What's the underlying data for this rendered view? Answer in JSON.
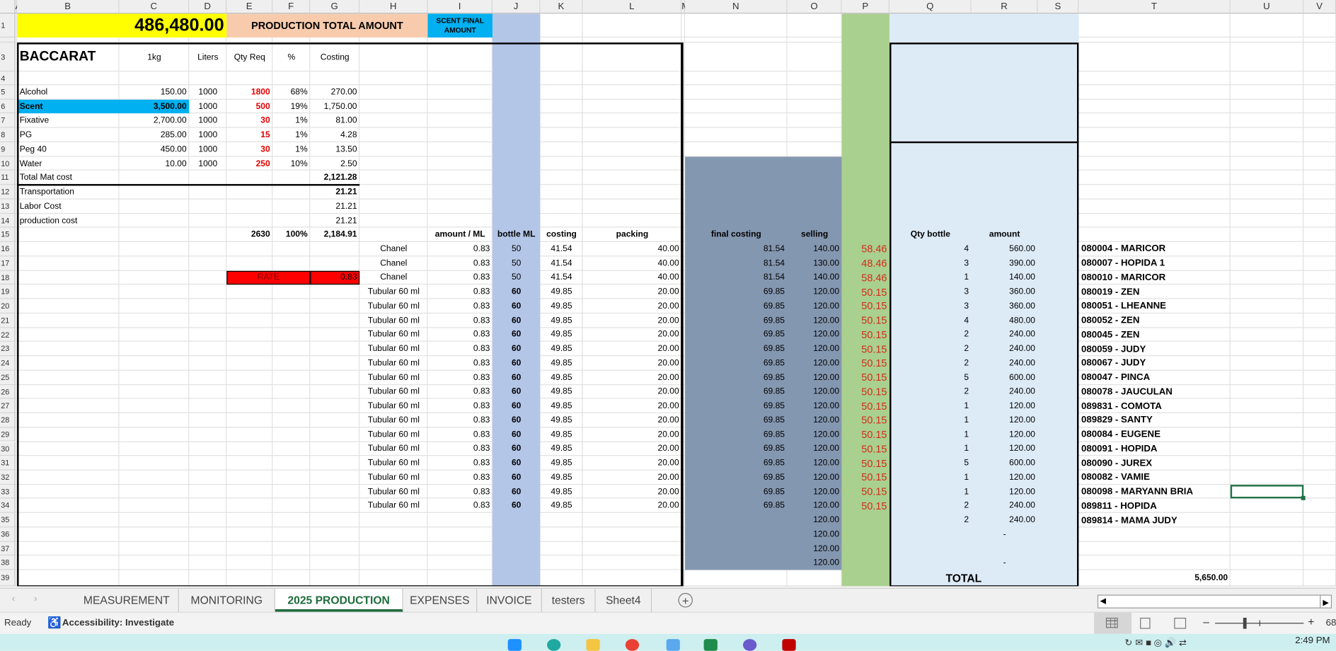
{
  "columns": [
    "A",
    "B",
    "C",
    "D",
    "E",
    "F",
    "G",
    "H",
    "I",
    "J",
    "K",
    "L",
    "M",
    "N",
    "O",
    "P",
    "Q",
    "R",
    "S",
    "T",
    "U",
    "V"
  ],
  "header": {
    "grand_total": "486,480.00",
    "production_total_label": "PRODUCTION TOTAL AMOUNT",
    "scent_final_label": "SCENT FINAL AMOUNT"
  },
  "recipe": {
    "title": "BACCARAT",
    "col_headers": [
      "1kg",
      "Liters",
      "Qty Req",
      "%",
      "Costing"
    ],
    "materials": [
      {
        "name": "Alcohol",
        "price": "150.00",
        "liters": "1000",
        "qty": "1800",
        "pct": "68%",
        "cost": "270.00"
      },
      {
        "name": "Scent",
        "price": "3,500.00",
        "liters": "1000",
        "qty": "500",
        "pct": "19%",
        "cost": "1,750.00"
      },
      {
        "name": "Fixative",
        "price": "2,700.00",
        "liters": "1000",
        "qty": "30",
        "pct": "1%",
        "cost": "81.00"
      },
      {
        "name": "PG",
        "price": "285.00",
        "liters": "1000",
        "qty": "15",
        "pct": "1%",
        "cost": "4.28"
      },
      {
        "name": "Peg 40",
        "price": "450.00",
        "liters": "1000",
        "qty": "30",
        "pct": "1%",
        "cost": "13.50"
      },
      {
        "name": "Water",
        "price": "10.00",
        "liters": "1000",
        "qty": "250",
        "pct": "10%",
        "cost": "2.50"
      }
    ],
    "totals": [
      {
        "label": "Total Mat cost",
        "value": "2,121.28"
      },
      {
        "label": "Transportation",
        "value": "21.21"
      },
      {
        "label": "Labor Cost",
        "value": "21.21"
      },
      {
        "label": "production cost",
        "value": "21.21"
      }
    ],
    "sum_qty": "2630",
    "sum_pct": "100%",
    "sum_cost": "2,184.91",
    "rate_label": "RATE",
    "rate_value": "0.83"
  },
  "product_headers": {
    "amount_ml": "amount / ML",
    "bottle_ml": "bottle  ML",
    "costing": "costing",
    "packing": "packing",
    "final": "final costing",
    "selling": "selling",
    "qty": "Qty bottle",
    "amount": "amount"
  },
  "products": [
    {
      "name": "Chanel",
      "aml": "0.83",
      "bottle": "50",
      "costing": "41.54",
      "packing": "40.00",
      "final": "81.54",
      "selling": "140.00",
      "margin": "58.46",
      "qty": "4",
      "amount": "560.00",
      "customer": "080004 - MARICOR"
    },
    {
      "name": "Chanel",
      "aml": "0.83",
      "bottle": "50",
      "costing": "41.54",
      "packing": "40.00",
      "final": "81.54",
      "selling": "130.00",
      "margin": "48.46",
      "qty": "3",
      "amount": "390.00",
      "customer": "080007 - HOPIDA 1"
    },
    {
      "name": "Chanel",
      "aml": "0.83",
      "bottle": "50",
      "costing": "41.54",
      "packing": "40.00",
      "final": "81.54",
      "selling": "140.00",
      "margin": "58.46",
      "qty": "1",
      "amount": "140.00",
      "customer": "080010 - MARICOR"
    },
    {
      "name": "Tubular  60 ml",
      "aml": "0.83",
      "bottle": "60",
      "costing": "49.85",
      "packing": "20.00",
      "final": "69.85",
      "selling": "120.00",
      "margin": "50.15",
      "qty": "3",
      "amount": "360.00",
      "customer": "080019 - ZEN"
    },
    {
      "name": "Tubular  60 ml",
      "aml": "0.83",
      "bottle": "60",
      "costing": "49.85",
      "packing": "20.00",
      "final": "69.85",
      "selling": "120.00",
      "margin": "50.15",
      "qty": "3",
      "amount": "360.00",
      "customer": "080051 - LHEANNE"
    },
    {
      "name": "Tubular  60 ml",
      "aml": "0.83",
      "bottle": "60",
      "costing": "49.85",
      "packing": "20.00",
      "final": "69.85",
      "selling": "120.00",
      "margin": "50.15",
      "qty": "4",
      "amount": "480.00",
      "customer": "080052 - ZEN"
    },
    {
      "name": "Tubular  60 ml",
      "aml": "0.83",
      "bottle": "60",
      "costing": "49.85",
      "packing": "20.00",
      "final": "69.85",
      "selling": "120.00",
      "margin": "50.15",
      "qty": "2",
      "amount": "240.00",
      "customer": "080045 - ZEN"
    },
    {
      "name": "Tubular  60 ml",
      "aml": "0.83",
      "bottle": "60",
      "costing": "49.85",
      "packing": "20.00",
      "final": "69.85",
      "selling": "120.00",
      "margin": "50.15",
      "qty": "2",
      "amount": "240.00",
      "customer": "080059 - JUDY"
    },
    {
      "name": "Tubular  60 ml",
      "aml": "0.83",
      "bottle": "60",
      "costing": "49.85",
      "packing": "20.00",
      "final": "69.85",
      "selling": "120.00",
      "margin": "50.15",
      "qty": "2",
      "amount": "240.00",
      "customer": "080067 - JUDY"
    },
    {
      "name": "Tubular  60 ml",
      "aml": "0.83",
      "bottle": "60",
      "costing": "49.85",
      "packing": "20.00",
      "final": "69.85",
      "selling": "120.00",
      "margin": "50.15",
      "qty": "5",
      "amount": "600.00",
      "customer": "080047 - PINCA"
    },
    {
      "name": "Tubular  60 ml",
      "aml": "0.83",
      "bottle": "60",
      "costing": "49.85",
      "packing": "20.00",
      "final": "69.85",
      "selling": "120.00",
      "margin": "50.15",
      "qty": "2",
      "amount": "240.00",
      "customer": "080078 - JAUCULAN"
    },
    {
      "name": "Tubular  60 ml",
      "aml": "0.83",
      "bottle": "60",
      "costing": "49.85",
      "packing": "20.00",
      "final": "69.85",
      "selling": "120.00",
      "margin": "50.15",
      "qty": "1",
      "amount": "120.00",
      "customer": "089831 - COMOTA"
    },
    {
      "name": "Tubular  60 ml",
      "aml": "0.83",
      "bottle": "60",
      "costing": "49.85",
      "packing": "20.00",
      "final": "69.85",
      "selling": "120.00",
      "margin": "50.15",
      "qty": "1",
      "amount": "120.00",
      "customer": "089829 - SANTY"
    },
    {
      "name": "Tubular  60 ml",
      "aml": "0.83",
      "bottle": "60",
      "costing": "49.85",
      "packing": "20.00",
      "final": "69.85",
      "selling": "120.00",
      "margin": "50.15",
      "qty": "1",
      "amount": "120.00",
      "customer": "080084 - EUGENE"
    },
    {
      "name": "Tubular  60 ml",
      "aml": "0.83",
      "bottle": "60",
      "costing": "49.85",
      "packing": "20.00",
      "final": "69.85",
      "selling": "120.00",
      "margin": "50.15",
      "qty": "1",
      "amount": "120.00",
      "customer": "080091 - HOPIDA"
    },
    {
      "name": "Tubular  60 ml",
      "aml": "0.83",
      "bottle": "60",
      "costing": "49.85",
      "packing": "20.00",
      "final": "69.85",
      "selling": "120.00",
      "margin": "50.15",
      "qty": "5",
      "amount": "600.00",
      "customer": "080090 - JUREX"
    },
    {
      "name": "Tubular  60 ml",
      "aml": "0.83",
      "bottle": "60",
      "costing": "49.85",
      "packing": "20.00",
      "final": "69.85",
      "selling": "120.00",
      "margin": "50.15",
      "qty": "1",
      "amount": "120.00",
      "customer": "080082 - VAMIE"
    },
    {
      "name": "Tubular  60 ml",
      "aml": "0.83",
      "bottle": "60",
      "costing": "49.85",
      "packing": "20.00",
      "final": "69.85",
      "selling": "120.00",
      "margin": "50.15",
      "qty": "1",
      "amount": "120.00",
      "customer": "080098 - MARYANN BRIA"
    },
    {
      "name": "Tubular  60 ml",
      "aml": "0.83",
      "bottle": "60",
      "costing": "49.85",
      "packing": "20.00",
      "final": "69.85",
      "selling": "120.00",
      "margin": "50.15",
      "qty": "2",
      "amount": "240.00",
      "customer": "089811 - HOPIDA"
    },
    {
      "name": "",
      "aml": "",
      "bottle": "",
      "costing": "",
      "packing": "",
      "final": "",
      "selling": "120.00",
      "margin": "",
      "qty": "2",
      "amount": "240.00",
      "customer": "089814 - MAMA  JUDY"
    },
    {
      "name": "",
      "aml": "",
      "bottle": "",
      "costing": "",
      "packing": "",
      "final": "",
      "selling": "120.00",
      "margin": "",
      "qty": "",
      "amount": "-",
      "customer": ""
    },
    {
      "name": "",
      "aml": "",
      "bottle": "",
      "costing": "",
      "packing": "",
      "final": "",
      "selling": "120.00",
      "margin": "",
      "qty": "",
      "amount": "",
      "customer": ""
    },
    {
      "name": "",
      "aml": "",
      "bottle": "",
      "costing": "",
      "packing": "",
      "final": "",
      "selling": "120.00",
      "margin": "",
      "qty": "",
      "amount": "-",
      "customer": ""
    }
  ],
  "footer": {
    "total_label": "TOTAL",
    "total_value": "5,650.00"
  },
  "sheet_tabs": [
    "MEASUREMENT",
    "MONITORING",
    "2025 PRODUCTION",
    "EXPENSES",
    "INVOICE",
    "testers",
    "Sheet4"
  ],
  "active_tab": "2025 PRODUCTION",
  "status": {
    "ready": "Ready",
    "accessibility": "Accessibility: Investigate",
    "zoom": "68"
  },
  "taskbar": {
    "time": "2:49 PM"
  },
  "colors": {
    "yellow": "#ffff00",
    "peach": "#f8cbad",
    "cyan": "#00b0f0",
    "lavender": "#b4c6e7",
    "slate": "#8497b0",
    "green": "#a9d08e",
    "lightblue": "#ddebf7",
    "red": "#ff0000"
  }
}
